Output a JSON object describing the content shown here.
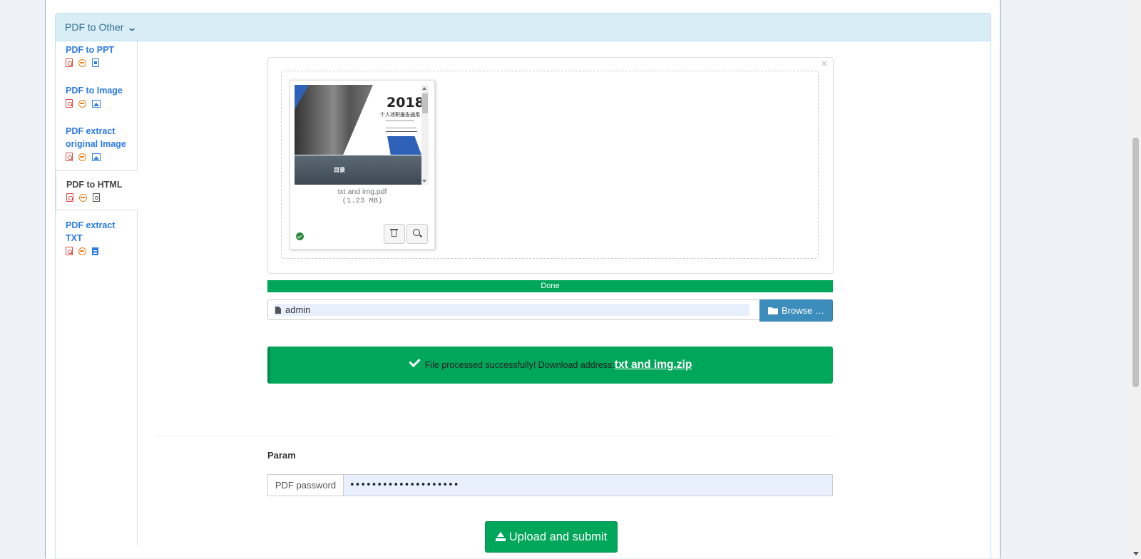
{
  "panel": {
    "title": "PDF to Other"
  },
  "sidebar": {
    "items": [
      {
        "label": "PDF to PPT",
        "active": false
      },
      {
        "label": "PDF to Image",
        "active": false
      },
      {
        "label": "PDF extract original Image",
        "active": false
      },
      {
        "label": "PDF to HTML",
        "active": true
      },
      {
        "label": "PDF extract TXT",
        "active": false
      }
    ]
  },
  "uploader": {
    "close": "×",
    "thumbnail": {
      "slide_year": "2018",
      "slide_subtitle": "个人述职报告通用",
      "slide_toc": "目录",
      "file_name": "txt and img.pdf",
      "file_size": "(1.23 MB)"
    }
  },
  "progress": {
    "label": "Done",
    "percent": 100
  },
  "file_input": {
    "caption": "admin",
    "browse_label": "Browse …"
  },
  "alert": {
    "message": "File processed successfully! Download address:",
    "link": "txt and img.zip"
  },
  "params": {
    "heading": "Param",
    "pdf_password_label": "PDF password",
    "pdf_password_value": "••••••••••••••••••••"
  },
  "submit": {
    "label": "Upload and submit"
  },
  "colors": {
    "success": "#00a65a",
    "primary": "#3c8dbc",
    "link": "#2c7be5",
    "panel_heading": "#d9edf7"
  }
}
